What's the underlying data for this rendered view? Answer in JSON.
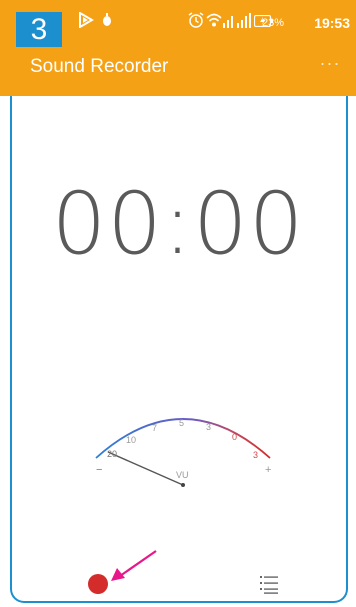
{
  "annotation": {
    "step_number": "3"
  },
  "status_bar": {
    "battery_percent": "23%",
    "time": "19:53"
  },
  "app": {
    "title": "Sound Recorder",
    "overflow_label": "···"
  },
  "timer": {
    "display": "00:00"
  },
  "vu_meter": {
    "label": "VU",
    "scale_labels": [
      "20",
      "10",
      "7",
      "5",
      "3",
      "0",
      "3"
    ],
    "minus_label": "−",
    "plus_label": "+"
  },
  "colors": {
    "accent": "#f5a115",
    "badge": "#1c8fcf",
    "record": "#d42b2b",
    "arrow": "#e8178a"
  },
  "icons": {
    "record": "record-circle-icon",
    "list": "recordings-list-icon",
    "overflow": "more-dots-icon"
  }
}
